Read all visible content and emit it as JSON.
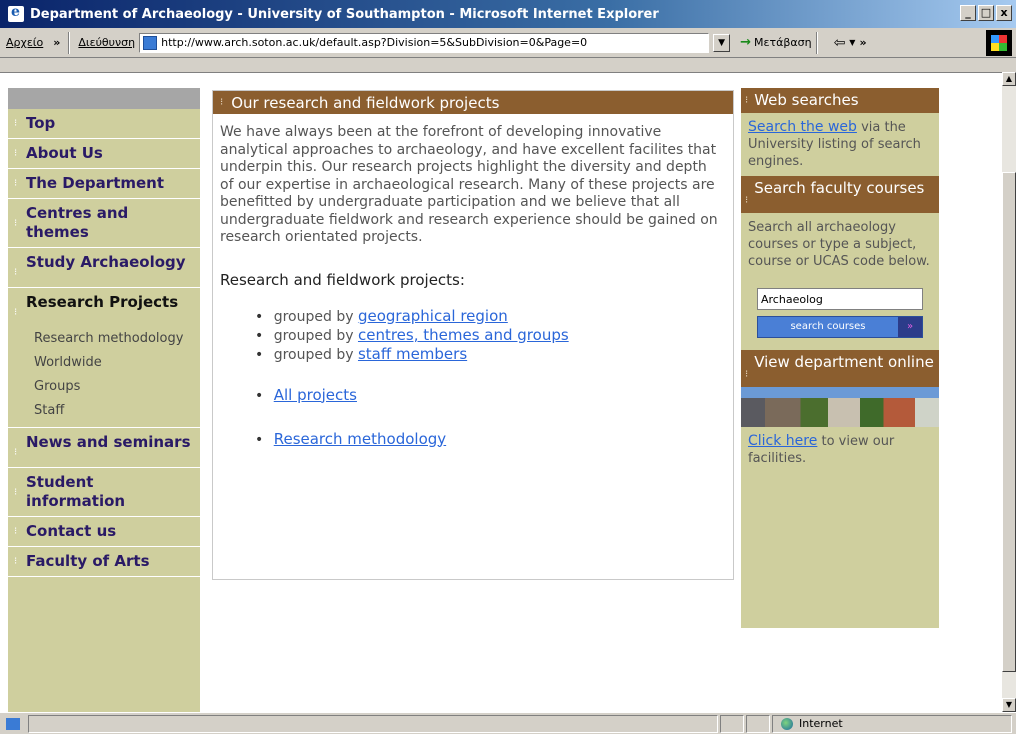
{
  "window": {
    "title": "Department of Archaeology - University of Southampton - Microsoft Internet Explorer",
    "min_label": "_",
    "max_label": "□",
    "close_label": "x"
  },
  "toolbar": {
    "file_menu": "Αρχείο",
    "chevron": "»",
    "address_label": "Διεύθυνση",
    "url": "http://www.arch.soton.ac.uk/default.asp?Division=5&SubDivision=0&Page=0",
    "go_label": "Μετάβαση"
  },
  "nav": {
    "items": [
      {
        "label": "Top"
      },
      {
        "label": "About Us"
      },
      {
        "label": "The Department"
      },
      {
        "label": "Centres and themes"
      },
      {
        "label": "Study Archaeology"
      },
      {
        "label": "Research Projects"
      },
      {
        "label": "News and seminars"
      },
      {
        "label": "Student information"
      },
      {
        "label": "Contact us"
      },
      {
        "label": "Faculty of Arts"
      }
    ],
    "sub_items": [
      "Research methodology",
      "Worldwide",
      "Groups",
      "Staff"
    ]
  },
  "main": {
    "heading": "Our research and fieldwork projects",
    "intro": "We have always been at the forefront of developing innovative analytical approaches to archaeology, and have excellent facilites that underpin this. Our research projects highlight the diversity and depth of our expertise in archaeological research. Many of these projects are benefitted by undergraduate participation and we believe that all undergraduate fieldwork and research experience should be gained on research orientated projects.",
    "projects_heading": "Research and fieldwork projects:",
    "grouped_prefix": "grouped by",
    "groups": [
      "geographical region",
      "centres, themes and groups",
      "staff members"
    ],
    "all_projects": "All projects",
    "research_methodology": "Research methodology"
  },
  "right": {
    "web_searches_heading": "Web searches",
    "search_web_link": "Search the web",
    "search_web_text": " via the University listing of search engines.",
    "faculty_heading": "Search faculty courses",
    "faculty_text": "Search all archaeology courses or type a subject, course or UCAS code below.",
    "course_input_value": "Archaeolog",
    "search_button": "search courses",
    "view_heading": "View department online",
    "click_here": "Click here",
    "click_here_text": " to view our facilities."
  },
  "status": {
    "zone": "Internet"
  },
  "colors": {
    "nav_bg": "#cfcf9e",
    "header_brown": "#8b5e2f",
    "link_blue": "#2a66d9"
  }
}
